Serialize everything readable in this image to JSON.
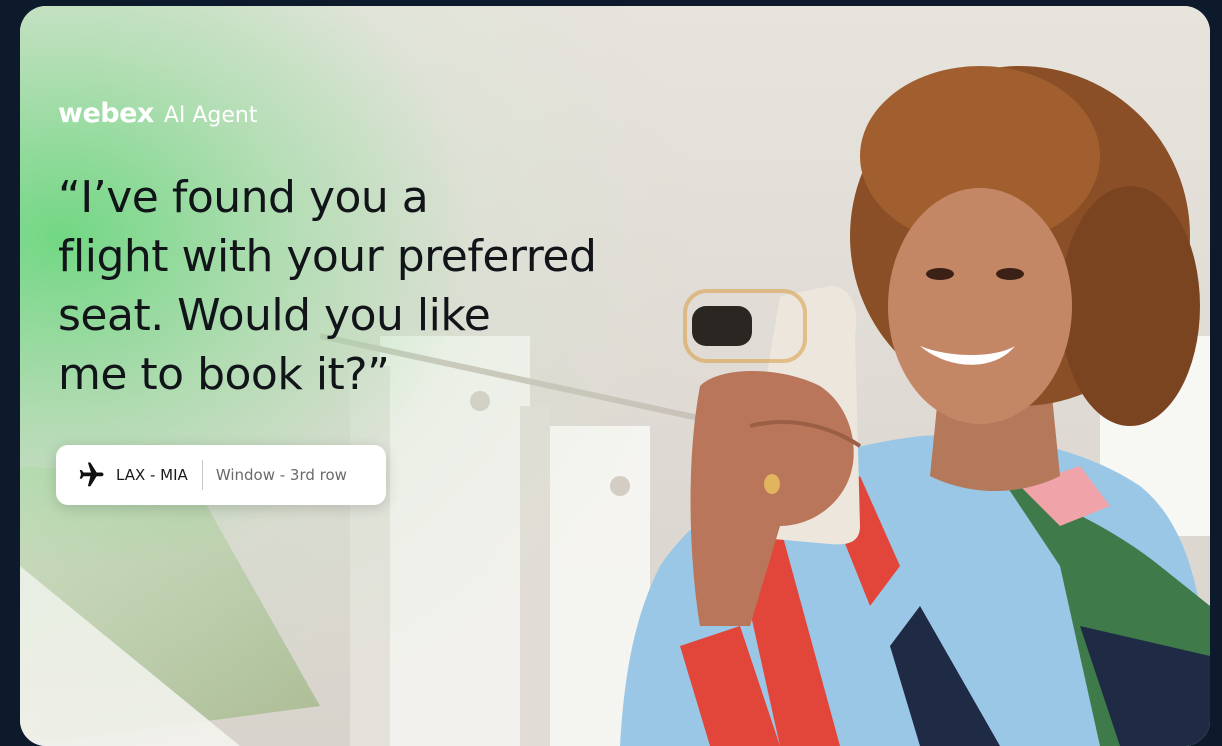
{
  "brand": {
    "logo": "webex",
    "product": "AI Agent"
  },
  "quote": {
    "lines": [
      "“I’ve found you a",
      "flight with your preferred",
      "seat. Would you like",
      "me to book it?”"
    ]
  },
  "flight_chip": {
    "icon": "airplane-icon",
    "route": "LAX - MIA",
    "seat": "Window - 3rd row"
  },
  "colors": {
    "page_background": "#0d1a2b",
    "accent_green": "#62d678",
    "text_dark": "#111418"
  }
}
